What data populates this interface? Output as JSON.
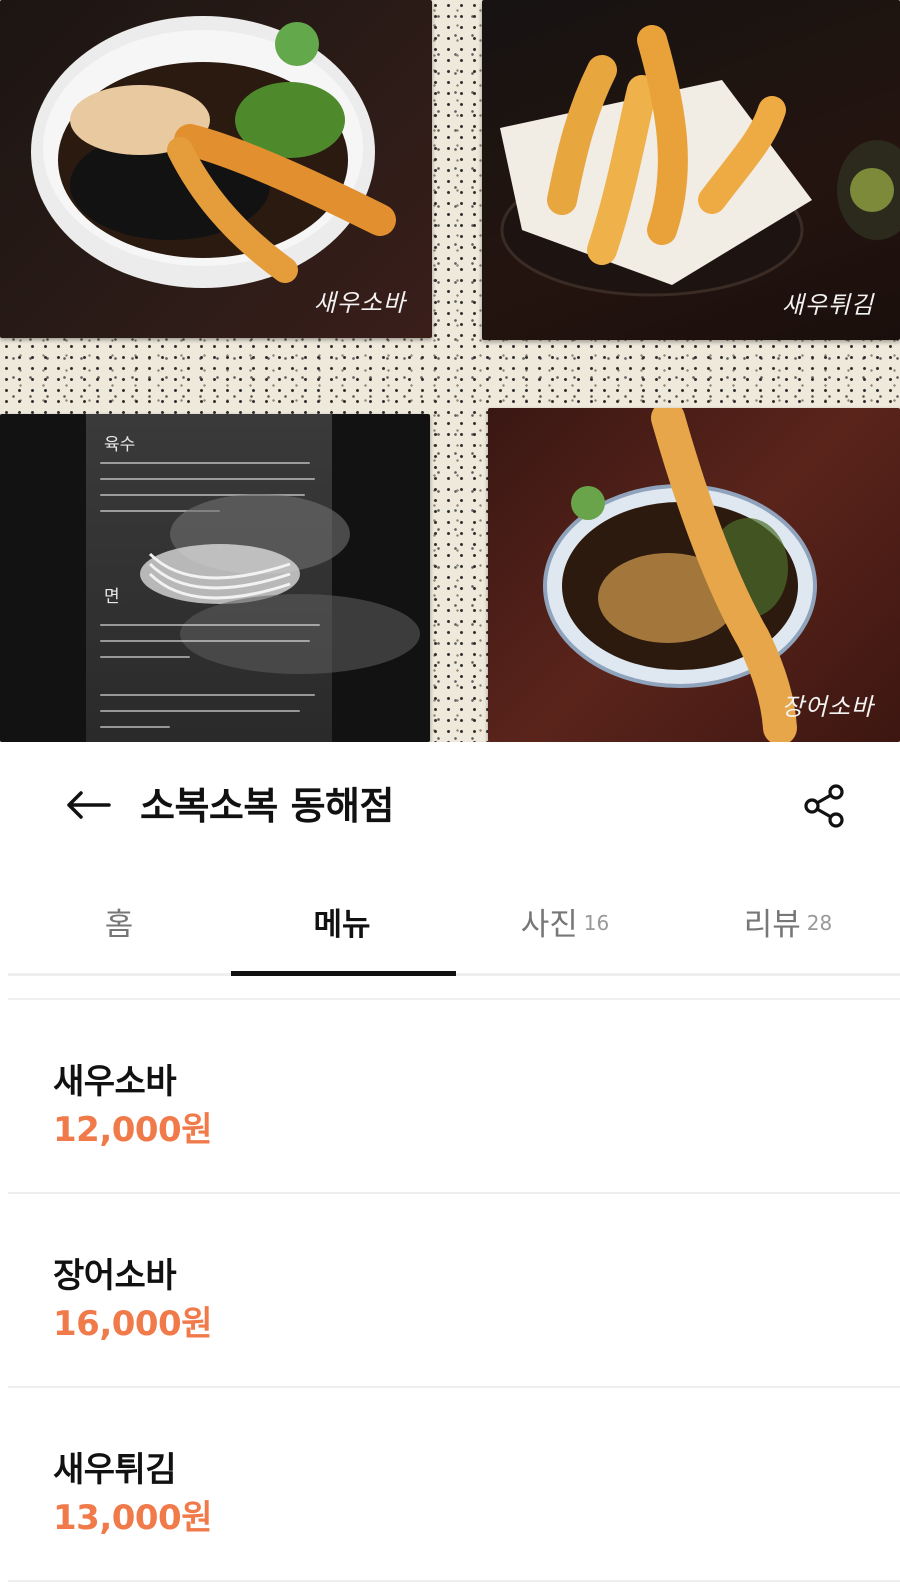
{
  "hero": {
    "photos": [
      {
        "caption": "새우소바",
        "icon": "bowl-of-noodles-with-shrimp-tempura"
      },
      {
        "caption": "새우튀김",
        "icon": "plate-of-shrimp-tempura"
      },
      {
        "caption": "",
        "icon": "handwritten-note-with-noodles"
      },
      {
        "caption": "장어소바",
        "icon": "bowl-of-noodles-with-eel-tempura"
      }
    ],
    "note_headings": [
      "육수",
      "면"
    ]
  },
  "header": {
    "title": "소복소복 동해점",
    "back_icon": "arrow-left-icon",
    "share_icon": "share-icon"
  },
  "tabs": [
    {
      "label": "홈",
      "count": "",
      "active": false
    },
    {
      "label": "메뉴",
      "count": "",
      "active": true
    },
    {
      "label": "사진",
      "count": "16",
      "active": false
    },
    {
      "label": "리뷰",
      "count": "28",
      "active": false
    }
  ],
  "menu": [
    {
      "name": "새우소바",
      "price": "12,000원"
    },
    {
      "name": "장어소바",
      "price": "16,000원"
    },
    {
      "name": "새우튀김",
      "price": "13,000원"
    }
  ],
  "colors": {
    "price": "#f07a4a",
    "tab_indicator": "#111111",
    "divider": "#eeeeee"
  }
}
